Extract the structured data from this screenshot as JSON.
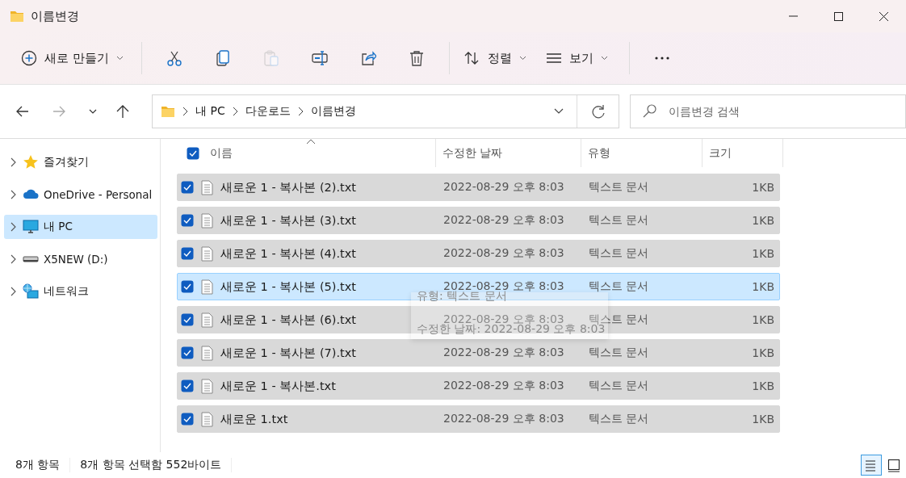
{
  "window": {
    "title": "이름변경"
  },
  "toolbar": {
    "new_button": {
      "label": "새로 만들기"
    },
    "actions": [
      {
        "kind": "cut",
        "disabled": false
      },
      {
        "kind": "copy",
        "disabled": false
      },
      {
        "kind": "paste",
        "disabled": true
      },
      {
        "kind": "rename",
        "disabled": false
      },
      {
        "kind": "share",
        "disabled": false
      },
      {
        "kind": "delete",
        "disabled": false
      }
    ],
    "sort": {
      "label": "정렬"
    },
    "view": {
      "label": "보기"
    }
  },
  "address": {
    "path": [
      "내 PC",
      "다운로드",
      "이름변경"
    ]
  },
  "search": {
    "placeholder": "이름변경 검색"
  },
  "sidebar": {
    "items": [
      {
        "label": "즐겨찾기",
        "kind": "star",
        "selected": false
      },
      {
        "label": "OneDrive - Personal",
        "kind": "cloud",
        "selected": false
      },
      {
        "label": "내 PC",
        "kind": "pc",
        "selected": true
      },
      {
        "label": "X5NEW (D:)",
        "kind": "drive",
        "selected": false
      },
      {
        "label": "네트워크",
        "kind": "network",
        "selected": false
      }
    ]
  },
  "table": {
    "all_checked": true,
    "columns": [
      {
        "label": "이름",
        "sorted": true
      },
      {
        "label": "수정한 날짜",
        "sorted": false
      },
      {
        "label": "유형",
        "sorted": false
      },
      {
        "label": "크기",
        "sorted": false
      }
    ],
    "rows": [
      {
        "name": "새로운 1 - 복사본 (2).txt",
        "date": "2022-08-29 오후 8:03",
        "type": "텍스트 문서",
        "size": "1KB",
        "checked": true,
        "hovered": false
      },
      {
        "name": "새로운 1 - 복사본 (3).txt",
        "date": "2022-08-29 오후 8:03",
        "type": "텍스트 문서",
        "size": "1KB",
        "checked": true,
        "hovered": false
      },
      {
        "name": "새로운 1 - 복사본 (4).txt",
        "date": "2022-08-29 오후 8:03",
        "type": "텍스트 문서",
        "size": "1KB",
        "checked": true,
        "hovered": false
      },
      {
        "name": "새로운 1 - 복사본 (5).txt",
        "date": "2022-08-29 오후 8:03",
        "type": "텍스트 문서",
        "size": "1KB",
        "checked": true,
        "hovered": true
      },
      {
        "name": "새로운 1 - 복사본 (6).txt",
        "date": "2022-08-29 오후 8:03",
        "type": "텍스트 문서",
        "size": "1KB",
        "checked": true,
        "hovered": false
      },
      {
        "name": "새로운 1 - 복사본 (7).txt",
        "date": "2022-08-29 오후 8:03",
        "type": "텍스트 문서",
        "size": "1KB",
        "checked": true,
        "hovered": false
      },
      {
        "name": "새로운 1 - 복사본.txt",
        "date": "2022-08-29 오후 8:03",
        "type": "텍스트 문서",
        "size": "1KB",
        "checked": true,
        "hovered": false
      },
      {
        "name": "새로운 1.txt",
        "date": "2022-08-29 오후 8:03",
        "type": "텍스트 문서",
        "size": "1KB",
        "checked": true,
        "hovered": false
      }
    ]
  },
  "tooltip": {
    "lines": [
      "유형: 텍스트 문서",
      "수정한 날짜: 2022-08-29 오후 8:03"
    ]
  },
  "status_bar": {
    "item_count": "8개 항목",
    "selection": "8개 항목 선택함 552바이트",
    "view_buttons": [
      {
        "kind": "details",
        "selected": true
      },
      {
        "kind": "tiles",
        "selected": false
      }
    ]
  }
}
